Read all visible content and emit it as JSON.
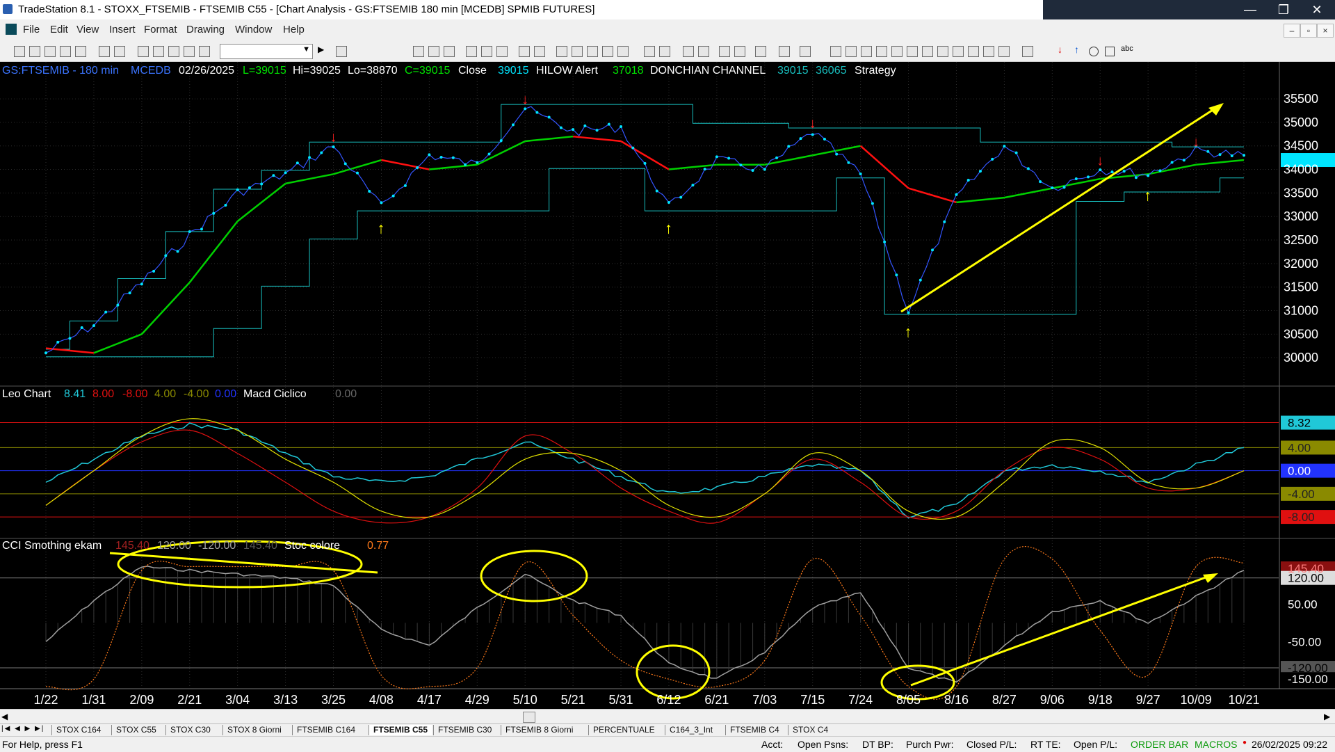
{
  "window": {
    "title": "TradeStation 8.1 - STOXX_FTSEMIB - FTSEMIB C55 - [Chart Analysis - GS:FTSEMIB  180 min  [MCEDB] SPMIB FUTURES]",
    "controls": [
      "—",
      "❐",
      "✕"
    ]
  },
  "menu": {
    "items": [
      "File",
      "Edit",
      "View",
      "Insert",
      "Format",
      "Drawing",
      "Window",
      "Help"
    ],
    "mdi_controls": [
      "–",
      "▫",
      "×"
    ]
  },
  "toolbar": {
    "symbol_box": "",
    "abc_label": "abc"
  },
  "colors": {
    "background": "#000000",
    "price": "#00e5ff",
    "price_bar": "#3355ff",
    "grid": "#2e2e2e",
    "donchian": "#18c0c0",
    "ma_up": "#00d000",
    "ma_down": "#ff1010",
    "leo_main": "#20c8d8",
    "leo_red": "#e01010",
    "leo_yellow": "#e0e000",
    "annotation": "#ffff00",
    "cci": "#a0a0a0",
    "stoc": "#ff7a1a"
  },
  "price_header": {
    "symbol": "GS:FTSEMIB - 180 min",
    "feed": "MCEDB",
    "date": "02/26/2025",
    "L": "L=39015",
    "Hi": "Hi=39025",
    "Lo": "Lo=38870",
    "C": "C=39015",
    "close_word": "Close",
    "close_val": "39015",
    "alert_name": "HILOW Alert",
    "alert_val": "37018",
    "channel_name": "DONCHIAN CHANNEL",
    "ch_up": "39015",
    "ch_dn": "36065",
    "strategy": "Strategy"
  },
  "leo_header": {
    "name": "Leo Chart",
    "v1": "8.41",
    "v2": "8.00",
    "v3": "-8.00",
    "v4": "4.00",
    "v5": "-4.00",
    "v6": "0.00",
    "name2": "Macd Ciclico",
    "v7": "0.00"
  },
  "cci_header": {
    "name": "CCI Smothing ekam",
    "v1": "145.40",
    "v2": "120.00",
    "v3": "-120.00",
    "v4": "145.40",
    "name2": "Stoc colore",
    "v5": "0.77"
  },
  "chart_data": [
    {
      "type": "line",
      "title": "GS:FTSEMIB - 180 min",
      "x": [
        "1/22",
        "1/31",
        "2/09",
        "2/21",
        "3/04",
        "3/13",
        "3/25",
        "4/08",
        "4/17",
        "4/29",
        "5/10",
        "5/21",
        "5/31",
        "6/12",
        "6/21",
        "7/03",
        "7/15",
        "7/24",
        "8/05",
        "8/16",
        "8/27",
        "9/06",
        "9/18",
        "9/27",
        "10/09",
        "10/21"
      ],
      "ylim": [
        29500,
        35900
      ],
      "yticks": [
        "35500",
        "35000",
        "34500",
        "34000",
        "33500",
        "33000",
        "32500",
        "32000",
        "31500",
        "31000",
        "30500",
        "30000"
      ],
      "series": [
        {
          "values": [
            30100,
            30700,
            31600,
            32600,
            33500,
            33900,
            34500,
            33200,
            34300,
            34100,
            35300,
            34800,
            34900,
            33200,
            34200,
            34000,
            34800,
            33900,
            31000,
            33400,
            34500,
            33600,
            34000,
            33900,
            34400,
            34300
          ]
        },
        {
          "values": [
            30200,
            30100,
            30500,
            31600,
            32900,
            33700,
            33900,
            34200,
            34000,
            34100,
            34600,
            34700,
            34600,
            34000,
            34100,
            34100,
            34300,
            34500,
            33600,
            33300,
            33400,
            33600,
            33800,
            33900,
            34100,
            34200
          ]
        }
      ],
      "last_price": "39015",
      "annotations": [
        "↑",
        "↑",
        "↑",
        "↑",
        "↓",
        "↓",
        "↓",
        "↓",
        "↓"
      ]
    },
    {
      "type": "line",
      "title": "Leo Chart",
      "ylim": [
        -11,
        12
      ],
      "yticks": [
        "8.32",
        "4.00",
        "0.00",
        "-4.00",
        "-8.00"
      ],
      "series": [
        {
          "values": [
            -2,
            2,
            6,
            8,
            7,
            3,
            -1,
            -2,
            -1,
            2,
            5,
            2,
            -1,
            -4,
            -3,
            -1,
            1,
            0,
            -8,
            -6,
            0,
            1,
            0,
            -2,
            1,
            4
          ]
        },
        {
          "values": [
            -6,
            0,
            5,
            7,
            3,
            -2,
            -7,
            -9,
            -8,
            -3,
            6,
            3,
            -3,
            -7,
            -9,
            -4,
            2,
            -2,
            -8,
            -7,
            0,
            4,
            2,
            -3,
            -3,
            0
          ]
        },
        {
          "values": [
            -6,
            0,
            6,
            9,
            7,
            2,
            -2,
            -7,
            -8,
            -4,
            2,
            3,
            0,
            -6,
            -8,
            -4,
            3,
            0,
            -7,
            -8,
            -2,
            5,
            4,
            -2,
            -3,
            0
          ]
        }
      ]
    },
    {
      "type": "area",
      "title": "CCI Smothing ekam",
      "ylim": [
        -170,
        190
      ],
      "yticks": [
        "145.40",
        "120.00",
        "50.00",
        "-50.00",
        "-120.00",
        "-150.00"
      ],
      "series": [
        {
          "values": [
            -50,
            60,
            150,
            140,
            130,
            120,
            100,
            -20,
            -60,
            40,
            130,
            60,
            20,
            -110,
            -150,
            -80,
            40,
            80,
            -120,
            -160,
            -60,
            30,
            60,
            0,
            70,
            140
          ]
        },
        {
          "values": [
            -170,
            -150,
            140,
            150,
            150,
            150,
            140,
            -140,
            -170,
            -120,
            160,
            20,
            -100,
            -150,
            -170,
            -100,
            170,
            20,
            -170,
            -170,
            170,
            170,
            -20,
            -140,
            150,
            160
          ]
        }
      ]
    }
  ]
}
